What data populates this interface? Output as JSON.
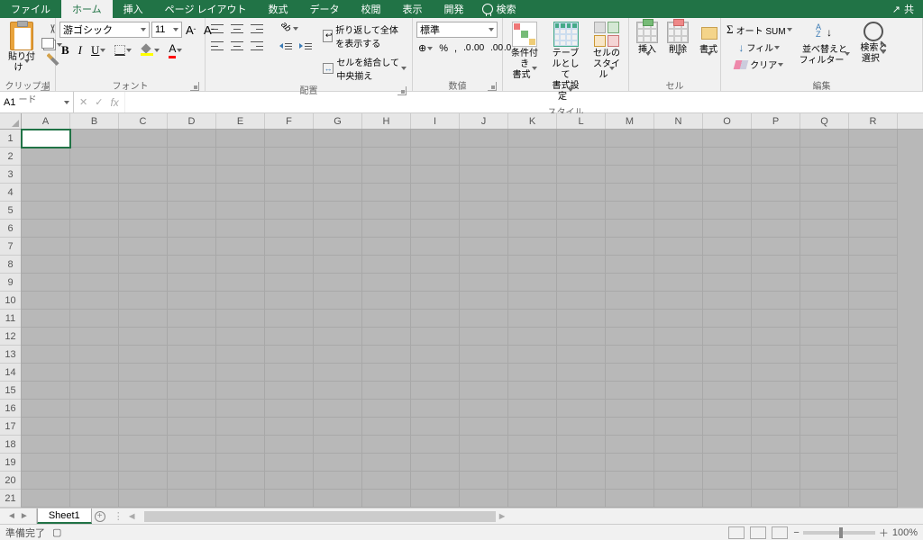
{
  "tabs": {
    "file": "ファイル",
    "home": "ホーム",
    "insert": "挿入",
    "pagelayout": "ページ レイアウト",
    "formulas": "数式",
    "data": "データ",
    "review": "校閲",
    "view": "表示",
    "developer": "開発",
    "search": "検索",
    "share": "共"
  },
  "groups": {
    "clipboard": "クリップボード",
    "font": "フォント",
    "alignment": "配置",
    "number": "数値",
    "styles": "スタイル",
    "cells": "セル",
    "editing": "編集"
  },
  "clipboard": {
    "paste": "貼り付け"
  },
  "font": {
    "name": "游ゴシック",
    "size": "11",
    "bold": "B",
    "italic": "I",
    "underline": "U",
    "color_letter": "A"
  },
  "alignment": {
    "wrap": "折り返して全体を表示する",
    "merge": "セルを結合して中央揃え"
  },
  "number": {
    "format": "標準",
    "percent": "%",
    "comma": ",",
    "inc": ".0 .00",
    "dec": ".00 .0"
  },
  "styles": {
    "cond": "条件付き\n書式",
    "table": "テーブルとして\n書式設定",
    "cell": "セルの\nスタイル"
  },
  "cells": {
    "insert": "挿入",
    "delete": "削除",
    "format": "書式"
  },
  "editing": {
    "autosum": "オート SUM",
    "fill": "フィル",
    "clear": "クリア",
    "sort": "並べ替えと\nフィルター",
    "find": "検索と\n選択"
  },
  "namebox": "A1",
  "columns": [
    "A",
    "B",
    "C",
    "D",
    "E",
    "F",
    "G",
    "H",
    "I",
    "J",
    "K",
    "L",
    "M",
    "N",
    "O",
    "P",
    "Q",
    "R"
  ],
  "rows": [
    "1",
    "2",
    "3",
    "4",
    "5",
    "6",
    "7",
    "8",
    "9",
    "10",
    "11",
    "12",
    "13",
    "14",
    "15",
    "16",
    "17",
    "18",
    "19",
    "20",
    "21"
  ],
  "active_cell": {
    "row": 0,
    "col": 0
  },
  "sheet": {
    "name": "Sheet1"
  },
  "status": {
    "ready": "準備完了",
    "zoom": "100%"
  }
}
